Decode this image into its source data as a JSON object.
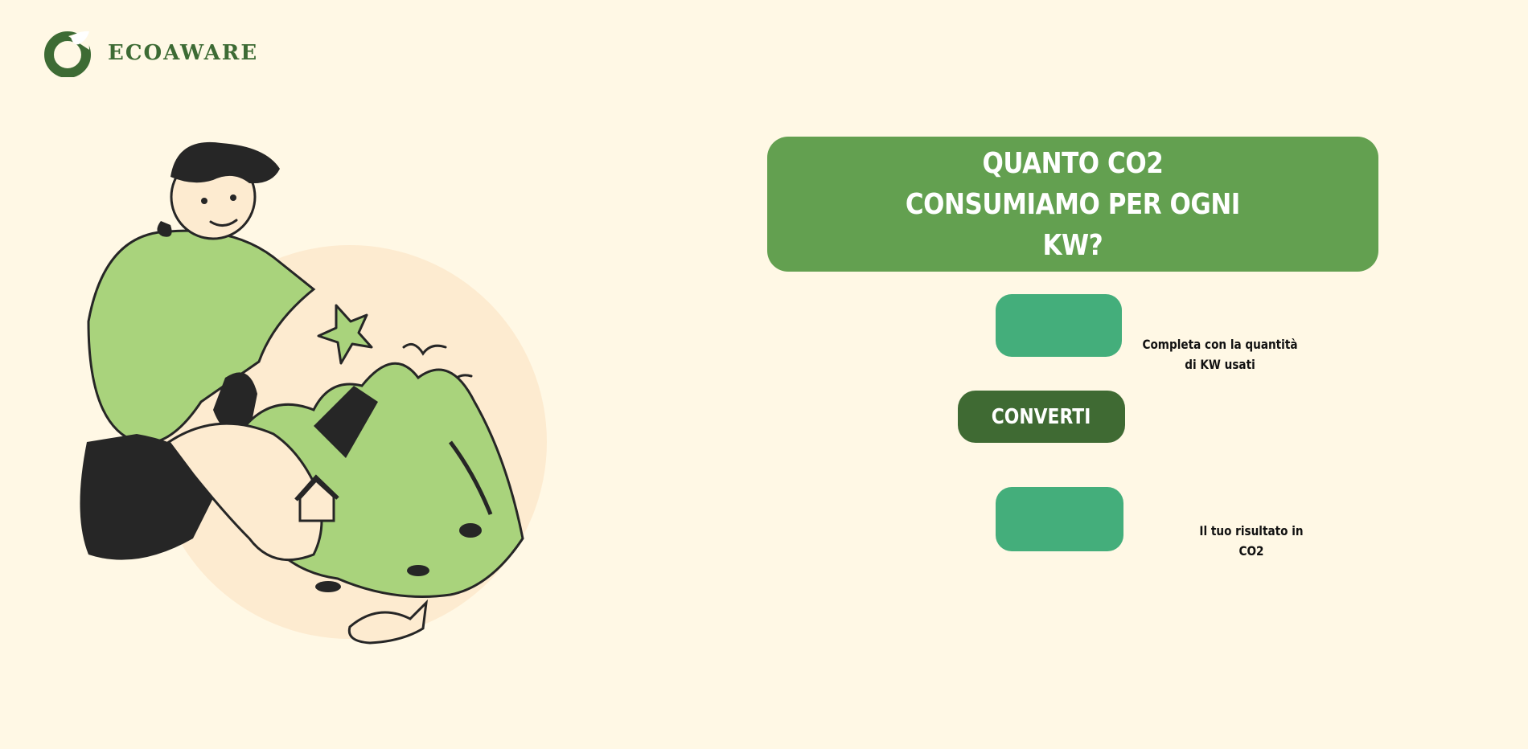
{
  "brand": {
    "name": "ECOAWARE",
    "logo_icon": "ecoaware-logo-icon",
    "primary_color": "#3d6b34"
  },
  "hero": {
    "illustration": "person-cradling-landscape-illustration"
  },
  "converter": {
    "title_lines": [
      "QUANTO CO2",
      "CONSUMIAMO PER OGNI",
      "KW?"
    ],
    "kw_input": {
      "value": "",
      "hint_lines": [
        "Completa con la quantità",
        "di KW usati"
      ]
    },
    "convert_label": "CONVERTI",
    "result_output": {
      "value": "",
      "hint": "Il tuo risultato in CO2"
    }
  },
  "colors": {
    "background": "#fff8e5",
    "title_banner": "#63a050",
    "input_fill": "#44ae7b",
    "button_fill": "#3f6a33",
    "illustration_green": "#a9d37c",
    "illustration_black": "#262626"
  }
}
